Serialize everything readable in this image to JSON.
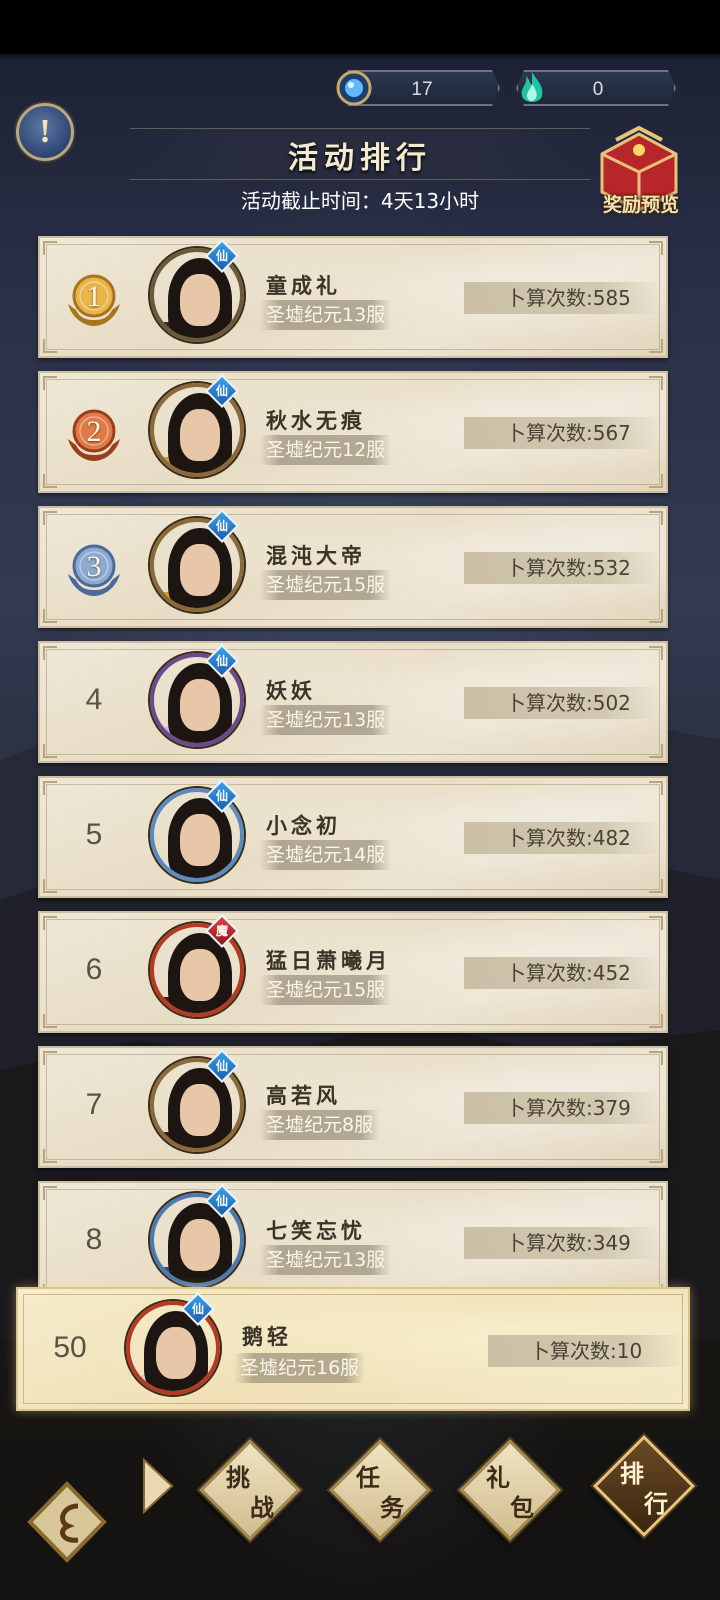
{
  "currencies": [
    {
      "icon": "blue-orb-icon",
      "value": "17"
    },
    {
      "icon": "green-flame-icon",
      "value": "0"
    }
  ],
  "header": {
    "title": "活动排行",
    "deadline": "活动截止时间：4天13小时",
    "reward_preview_label": "奖励预览"
  },
  "ranking": [
    {
      "rank": "1",
      "name": "童成礼",
      "server": "圣墟纪元13服",
      "count": "卜算次数:585",
      "badge": "仙"
    },
    {
      "rank": "2",
      "name": "秋水无痕",
      "server": "圣墟纪元12服",
      "count": "卜算次数:567",
      "badge": "仙"
    },
    {
      "rank": "3",
      "name": "混沌大帝",
      "server": "圣墟纪元15服",
      "count": "卜算次数:532",
      "badge": "仙"
    },
    {
      "rank": "4",
      "name": "妖妖",
      "server": "圣墟纪元13服",
      "count": "卜算次数:502",
      "badge": "仙"
    },
    {
      "rank": "5",
      "name": "小念初",
      "server": "圣墟纪元14服",
      "count": "卜算次数:482",
      "badge": "仙"
    },
    {
      "rank": "6",
      "name": "猛日萧曦月",
      "server": "圣墟纪元15服",
      "count": "卜算次数:452",
      "badge": "魔"
    },
    {
      "rank": "7",
      "name": "高若风",
      "server": "圣墟纪元8服",
      "count": "卜算次数:379",
      "badge": "仙"
    },
    {
      "rank": "8",
      "name": "七笑忘忧",
      "server": "圣墟纪元13服",
      "count": "卜算次数:349",
      "badge": "仙"
    }
  ],
  "my_rank": {
    "rank": "50",
    "name": "鹅轻",
    "server": "圣墟纪元16服",
    "count": "卜算次数:10",
    "badge": "仙"
  },
  "bottom_nav": [
    {
      "t1": "挑",
      "t2": "战"
    },
    {
      "t1": "任",
      "t2": "务"
    },
    {
      "t1": "礼",
      "t2": "包"
    },
    {
      "t1": "排",
      "t2": "行"
    }
  ],
  "colors": {
    "gold": "#c99a3a",
    "silver_bronze": "#c46a3a",
    "blue_medal": "#6a8ab6",
    "card_bg": "#ece4d3",
    "my_card_bg": "#f3e6c2"
  }
}
